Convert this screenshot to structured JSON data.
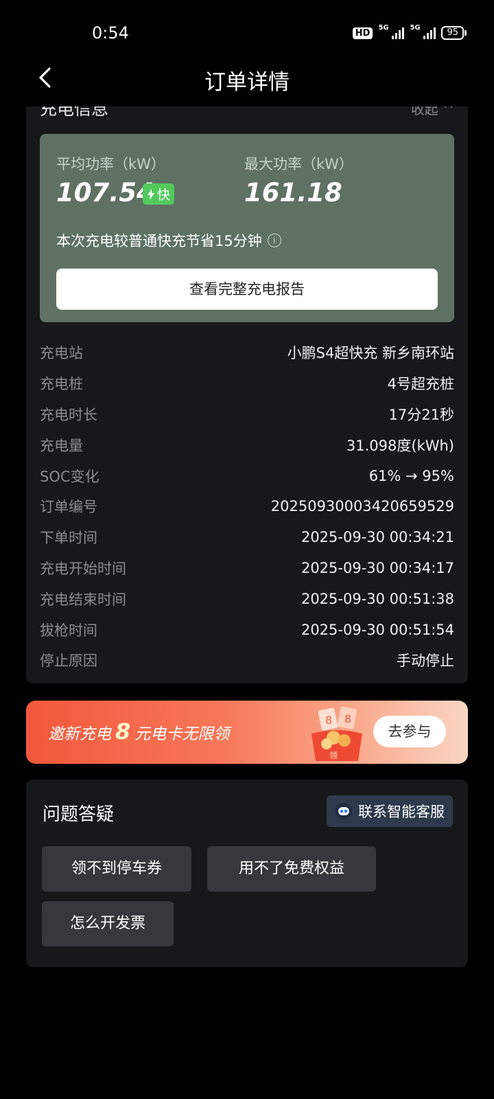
{
  "status_bar": {
    "time": "0:54",
    "hd": "HD",
    "network_1": "5G",
    "network_2": "5G",
    "battery": "95"
  },
  "header": {
    "title": "订单详情"
  },
  "charging_info": {
    "section_title": "充电信息",
    "collapse_label": "收起 ^",
    "avg_power_label": "平均功率（kW）",
    "avg_power_value": "107.54",
    "fast_badge": "快",
    "max_power_label": "最大功率（kW）",
    "max_power_value": "161.18",
    "saving_text": "本次充电较普通快充节省15分钟",
    "report_button": "查看完整充电报告",
    "rows": [
      {
        "label": "充电站",
        "value": "小鹏S4超快充 新乡南环站"
      },
      {
        "label": "充电桩",
        "value": "4号超充桩"
      },
      {
        "label": "充电时长",
        "value": "17分21秒"
      },
      {
        "label": "充电量",
        "value": "31.098度(kWh)"
      },
      {
        "label": "SOC变化",
        "value": "61% → 95%"
      },
      {
        "label": "订单编号",
        "value": "20250930003420659529"
      },
      {
        "label": "下单时间",
        "value": "2025-09-30 00:34:21"
      },
      {
        "label": "充电开始时间",
        "value": "2025-09-30 00:34:17"
      },
      {
        "label": "充电结束时间",
        "value": "2025-09-30 00:51:38"
      },
      {
        "label": "拔枪时间",
        "value": "2025-09-30 00:51:54"
      },
      {
        "label": "停止原因",
        "value": "手动停止"
      }
    ]
  },
  "banner": {
    "text_left": "邀新充电",
    "amount": "8",
    "text_right": "元电卡无限领",
    "art_label": "领",
    "button": "去参与"
  },
  "faq": {
    "title": "问题答疑",
    "service_button": "联系智能客服",
    "chips": [
      "领不到停车券",
      "用不了免费权益",
      "怎么开发票"
    ]
  },
  "colors": {
    "power_box": "#5e7163",
    "fast_badge": "#53c95c",
    "card_bg": "#17181a"
  }
}
